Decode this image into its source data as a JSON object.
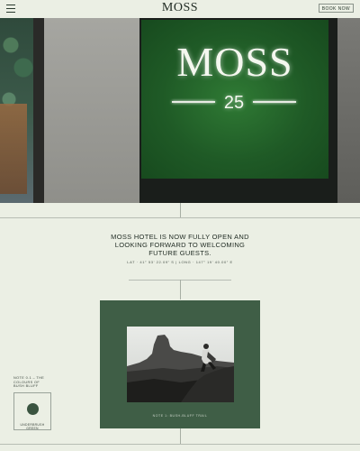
{
  "header": {
    "menu_icon": "hamburger-menu-icon",
    "logo": "MOSS",
    "book_label": "BOOK NOW"
  },
  "hero": {
    "sign_title": "MOSS",
    "sign_number": "25"
  },
  "announcement": {
    "text": "MOSS HOTEL IS NOW FULLY OPEN AND LOOKING FORWARD TO WELCOMING FUTURE GUESTS.",
    "coordinates": "LAT · 41° 53’ 22.09” S | LONG · 147° 19’ 40.00” E"
  },
  "gallery": {
    "caption": "NOTE 1: BUSH-BLUFF TRAIL"
  },
  "note": {
    "text": "NOTE 0.1 – THE COLOURS OF BUSH BLUFF",
    "swatch_label": "UNDERBRUSH GREEN",
    "swatch_color": "#3a5440"
  },
  "colors": {
    "background": "#ebefe4",
    "card_green": "#3f5e46"
  }
}
